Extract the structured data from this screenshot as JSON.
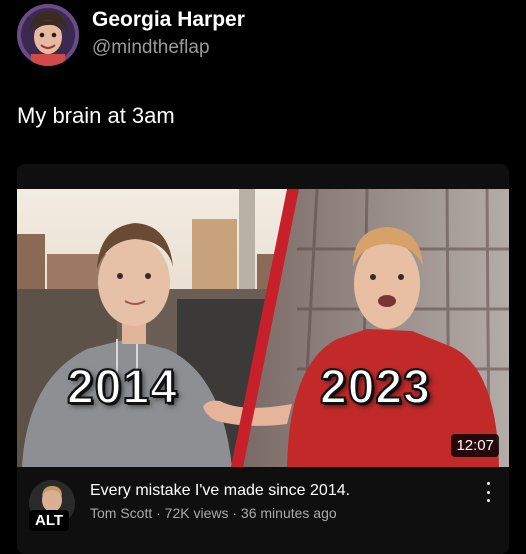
{
  "post": {
    "author_name": "Georgia Harper",
    "author_handle": "@mindtheflap",
    "text": "My brain at 3am"
  },
  "video": {
    "year_left": "2014",
    "year_right": "2023",
    "duration": "12:07",
    "alt_badge": "ALT",
    "title": "Every mistake I've made since 2014.",
    "meta": "Tom Scott · 72K views · 36 minutes ago",
    "icons": [
      "kebab-menu-icon"
    ]
  },
  "colors": {
    "background": "#000000",
    "card": "#0f0f0f",
    "divider_red": "#c8202a",
    "shirt_red": "#c22a2a",
    "hoodie_grey": "#8d8f93",
    "handle_grey": "#9a9a9a"
  }
}
